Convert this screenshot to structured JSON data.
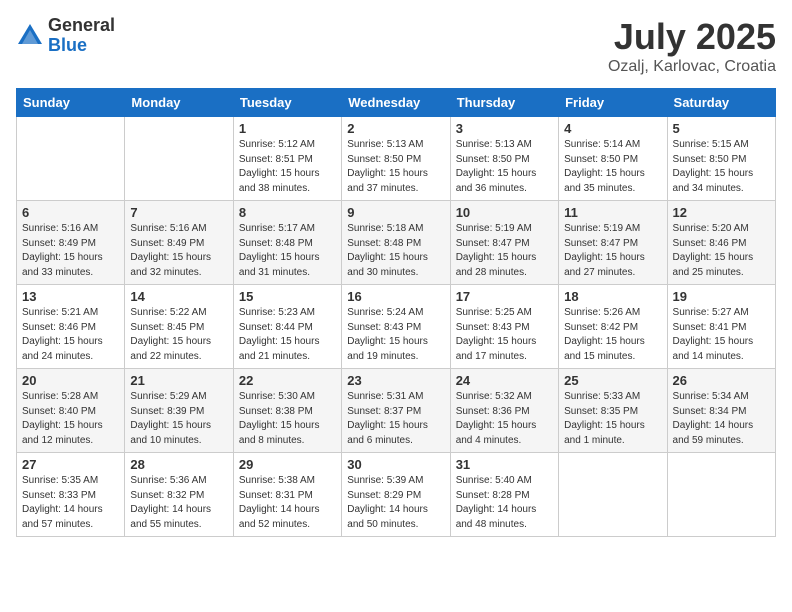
{
  "logo": {
    "general": "General",
    "blue": "Blue"
  },
  "title": "July 2025",
  "subtitle": "Ozalj, Karlovac, Croatia",
  "days_of_week": [
    "Sunday",
    "Monday",
    "Tuesday",
    "Wednesday",
    "Thursday",
    "Friday",
    "Saturday"
  ],
  "weeks": [
    [
      {
        "day": "",
        "info": ""
      },
      {
        "day": "",
        "info": ""
      },
      {
        "day": "1",
        "info": "Sunrise: 5:12 AM\nSunset: 8:51 PM\nDaylight: 15 hours and 38 minutes."
      },
      {
        "day": "2",
        "info": "Sunrise: 5:13 AM\nSunset: 8:50 PM\nDaylight: 15 hours and 37 minutes."
      },
      {
        "day": "3",
        "info": "Sunrise: 5:13 AM\nSunset: 8:50 PM\nDaylight: 15 hours and 36 minutes."
      },
      {
        "day": "4",
        "info": "Sunrise: 5:14 AM\nSunset: 8:50 PM\nDaylight: 15 hours and 35 minutes."
      },
      {
        "day": "5",
        "info": "Sunrise: 5:15 AM\nSunset: 8:50 PM\nDaylight: 15 hours and 34 minutes."
      }
    ],
    [
      {
        "day": "6",
        "info": "Sunrise: 5:16 AM\nSunset: 8:49 PM\nDaylight: 15 hours and 33 minutes."
      },
      {
        "day": "7",
        "info": "Sunrise: 5:16 AM\nSunset: 8:49 PM\nDaylight: 15 hours and 32 minutes."
      },
      {
        "day": "8",
        "info": "Sunrise: 5:17 AM\nSunset: 8:48 PM\nDaylight: 15 hours and 31 minutes."
      },
      {
        "day": "9",
        "info": "Sunrise: 5:18 AM\nSunset: 8:48 PM\nDaylight: 15 hours and 30 minutes."
      },
      {
        "day": "10",
        "info": "Sunrise: 5:19 AM\nSunset: 8:47 PM\nDaylight: 15 hours and 28 minutes."
      },
      {
        "day": "11",
        "info": "Sunrise: 5:19 AM\nSunset: 8:47 PM\nDaylight: 15 hours and 27 minutes."
      },
      {
        "day": "12",
        "info": "Sunrise: 5:20 AM\nSunset: 8:46 PM\nDaylight: 15 hours and 25 minutes."
      }
    ],
    [
      {
        "day": "13",
        "info": "Sunrise: 5:21 AM\nSunset: 8:46 PM\nDaylight: 15 hours and 24 minutes."
      },
      {
        "day": "14",
        "info": "Sunrise: 5:22 AM\nSunset: 8:45 PM\nDaylight: 15 hours and 22 minutes."
      },
      {
        "day": "15",
        "info": "Sunrise: 5:23 AM\nSunset: 8:44 PM\nDaylight: 15 hours and 21 minutes."
      },
      {
        "day": "16",
        "info": "Sunrise: 5:24 AM\nSunset: 8:43 PM\nDaylight: 15 hours and 19 minutes."
      },
      {
        "day": "17",
        "info": "Sunrise: 5:25 AM\nSunset: 8:43 PM\nDaylight: 15 hours and 17 minutes."
      },
      {
        "day": "18",
        "info": "Sunrise: 5:26 AM\nSunset: 8:42 PM\nDaylight: 15 hours and 15 minutes."
      },
      {
        "day": "19",
        "info": "Sunrise: 5:27 AM\nSunset: 8:41 PM\nDaylight: 15 hours and 14 minutes."
      }
    ],
    [
      {
        "day": "20",
        "info": "Sunrise: 5:28 AM\nSunset: 8:40 PM\nDaylight: 15 hours and 12 minutes."
      },
      {
        "day": "21",
        "info": "Sunrise: 5:29 AM\nSunset: 8:39 PM\nDaylight: 15 hours and 10 minutes."
      },
      {
        "day": "22",
        "info": "Sunrise: 5:30 AM\nSunset: 8:38 PM\nDaylight: 15 hours and 8 minutes."
      },
      {
        "day": "23",
        "info": "Sunrise: 5:31 AM\nSunset: 8:37 PM\nDaylight: 15 hours and 6 minutes."
      },
      {
        "day": "24",
        "info": "Sunrise: 5:32 AM\nSunset: 8:36 PM\nDaylight: 15 hours and 4 minutes."
      },
      {
        "day": "25",
        "info": "Sunrise: 5:33 AM\nSunset: 8:35 PM\nDaylight: 15 hours and 1 minute."
      },
      {
        "day": "26",
        "info": "Sunrise: 5:34 AM\nSunset: 8:34 PM\nDaylight: 14 hours and 59 minutes."
      }
    ],
    [
      {
        "day": "27",
        "info": "Sunrise: 5:35 AM\nSunset: 8:33 PM\nDaylight: 14 hours and 57 minutes."
      },
      {
        "day": "28",
        "info": "Sunrise: 5:36 AM\nSunset: 8:32 PM\nDaylight: 14 hours and 55 minutes."
      },
      {
        "day": "29",
        "info": "Sunrise: 5:38 AM\nSunset: 8:31 PM\nDaylight: 14 hours and 52 minutes."
      },
      {
        "day": "30",
        "info": "Sunrise: 5:39 AM\nSunset: 8:29 PM\nDaylight: 14 hours and 50 minutes."
      },
      {
        "day": "31",
        "info": "Sunrise: 5:40 AM\nSunset: 8:28 PM\nDaylight: 14 hours and 48 minutes."
      },
      {
        "day": "",
        "info": ""
      },
      {
        "day": "",
        "info": ""
      }
    ]
  ]
}
